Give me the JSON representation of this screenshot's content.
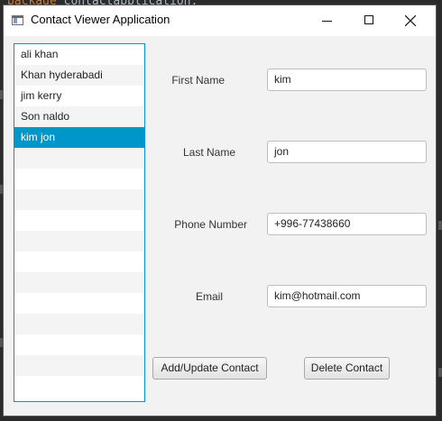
{
  "ide": {
    "code_keyword": "package",
    "code_rest": "contactapplication;"
  },
  "window": {
    "title": "Contact Viewer Application"
  },
  "contacts": {
    "items": [
      "ali khan",
      "Khan hyderabadi",
      "jim kerry",
      "Son naldo",
      "kim jon"
    ],
    "selected_index": 4
  },
  "form": {
    "first_name_label": "First Name",
    "first_name_value": "kim",
    "last_name_label": "Last Name",
    "last_name_value": "jon",
    "phone_label": "Phone Number",
    "phone_value": "+996-77438660",
    "email_label": "Email",
    "email_value": "kim@hotmail.com"
  },
  "buttons": {
    "add_update": "Add/Update Contact",
    "delete": "Delete Contact"
  }
}
